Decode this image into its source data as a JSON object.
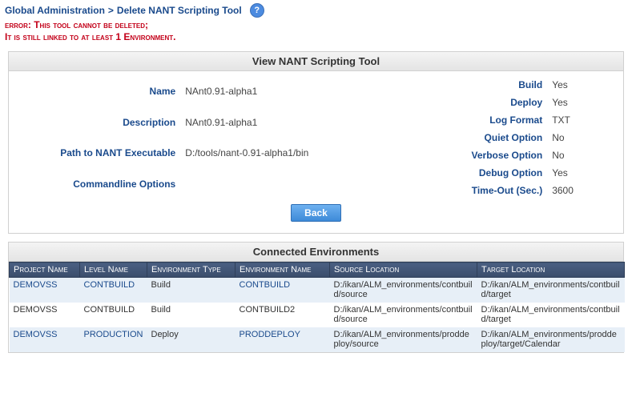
{
  "breadcrumb": {
    "root": "Global Administration",
    "sep": ">",
    "page": "Delete NANT Scripting Tool"
  },
  "error": {
    "line1": "error: This tool cannot be deleted;",
    "line2": "It is still linked to at least 1 Environment."
  },
  "view_panel": {
    "title": "View NANT Scripting Tool",
    "left": {
      "name_label": "Name",
      "name_value": "NAnt0.91-alpha1",
      "desc_label": "Description",
      "desc_value": "NAnt0.91-alpha1",
      "path_label": "Path to NANT Executable",
      "path_value": "D:/tools/nant-0.91-alpha1/bin",
      "cmd_label": "Commandline Options",
      "cmd_value": ""
    },
    "right": {
      "build_label": "Build",
      "build_value": "Yes",
      "deploy_label": "Deploy",
      "deploy_value": "Yes",
      "logfmt_label": "Log Format",
      "logfmt_value": "TXT",
      "quiet_label": "Quiet Option",
      "quiet_value": "No",
      "verbose_label": "Verbose Option",
      "verbose_value": "No",
      "debug_label": "Debug Option",
      "debug_value": "Yes",
      "timeout_label": "Time-Out (Sec.)",
      "timeout_value": "3600"
    },
    "back_label": "Back"
  },
  "env_panel": {
    "title": "Connected Environments",
    "headers": {
      "project": "Project Name",
      "level": "Level Name",
      "envtype": "Environment Type",
      "envname": "Environment Name",
      "source": "Source Location",
      "target": "Target Location"
    },
    "rows": [
      {
        "project": "DEMOVSS",
        "level": "CONTBUILD",
        "envtype": "Build",
        "envname": "CONTBUILD",
        "source": "D:/ikan/ALM_environments/contbuild/source",
        "target": "D:/ikan/ALM_environments/contbuild/target",
        "linked": true
      },
      {
        "project": "DEMOVSS",
        "level": "CONTBUILD",
        "envtype": "Build",
        "envname": "CONTBUILD2",
        "source": "D:/ikan/ALM_environments/contbuild/source",
        "target": "D:/ikan/ALM_environments/contbuild/target",
        "linked": false
      },
      {
        "project": "DEMOVSS",
        "level": "PRODUCTION",
        "envtype": "Deploy",
        "envname": "PRODDEPLOY",
        "source": "D:/ikan/ALM_environments/proddeploy/source",
        "target": "D:/ikan/ALM_environments/proddeploy/target/Calendar",
        "linked": true
      }
    ]
  }
}
